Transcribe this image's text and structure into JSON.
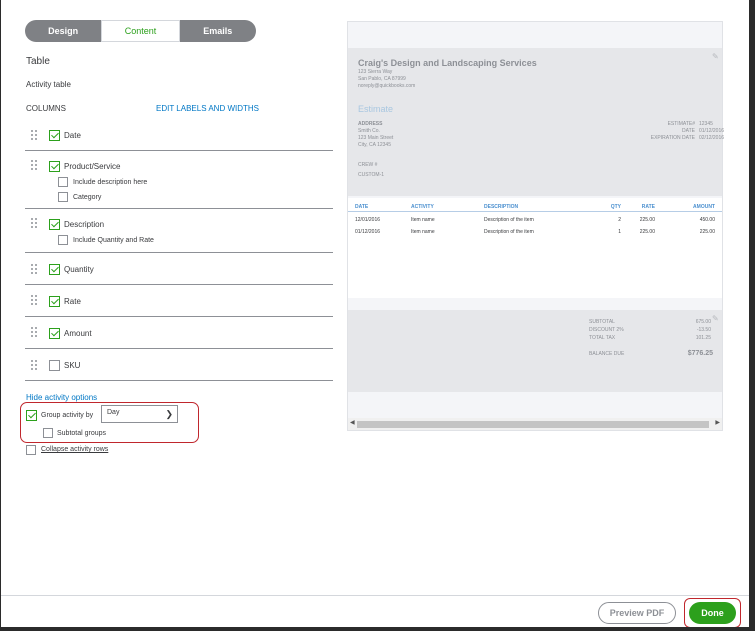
{
  "tabs": [
    {
      "label": "Design"
    },
    {
      "label": "Content"
    },
    {
      "label": "Emails"
    }
  ],
  "section": {
    "title": "Table",
    "subtitle": "Activity table",
    "columns_label": "COLUMNS",
    "edit_link": "EDIT LABELS AND WIDTHS"
  },
  "columns": [
    {
      "label": "Date",
      "checked": true
    },
    {
      "label": "Product/Service",
      "checked": true,
      "subs": [
        {
          "label": "Include description here",
          "checked": false
        },
        {
          "label": "Category",
          "checked": false
        }
      ]
    },
    {
      "label": "Description",
      "checked": true,
      "subs": [
        {
          "label": "Include Quantity and Rate",
          "checked": false
        }
      ]
    },
    {
      "label": "Quantity",
      "checked": true
    },
    {
      "label": "Rate",
      "checked": true
    },
    {
      "label": "Amount",
      "checked": true
    },
    {
      "label": "SKU",
      "checked": false
    }
  ],
  "options": {
    "hide_link": "Hide activity options",
    "group_label": "Group activity by",
    "group_value": "Day",
    "subtotal_label": "Subtotal groups",
    "collapse_label": "Collapse activity rows"
  },
  "preview": {
    "company": "Craig's Design and Landscaping Services",
    "company_addr": [
      "123 Sierra Way",
      "San Pablo, CA 87999",
      "noreply@quickbooks.com"
    ],
    "doc_title": "Estimate",
    "address_label": "ADDRESS",
    "address": [
      "Smith Co.",
      "123 Main Street",
      "City, CA 12345"
    ],
    "meta": [
      {
        "k": "ESTIMATE#",
        "v": "12345"
      },
      {
        "k": "DATE",
        "v": "01/12/2016"
      },
      {
        "k": "EXPIRATION DATE",
        "v": "02/12/2016"
      }
    ],
    "crew_label": "CREW #",
    "crew_value": "CUSTOM-1",
    "table_headers": [
      "DATE",
      "ACTIVITY",
      "DESCRIPTION",
      "QTY",
      "RATE",
      "AMOUNT"
    ],
    "rows": [
      [
        "12/01/2016",
        "Item name",
        "Description of the item",
        "2",
        "225.00",
        "450.00"
      ],
      [
        "01/12/2016",
        "Item name",
        "Description of the item",
        "1",
        "225.00",
        "225.00"
      ]
    ],
    "totals": [
      {
        "k": "SUBTOTAL",
        "v": "675.00"
      },
      {
        "k": "DISCOUNT 2%",
        "v": "-13.50"
      },
      {
        "k": "TOTAL TAX",
        "v": "101.25"
      }
    ],
    "balance_label": "BALANCE DUE",
    "balance_value": "$776.25"
  },
  "footer": {
    "pdf_label": "Preview PDF",
    "done_label": "Done"
  },
  "colors": {
    "accent": "#2ca01c",
    "link": "#0077c5",
    "highlight": "#c0272d"
  }
}
